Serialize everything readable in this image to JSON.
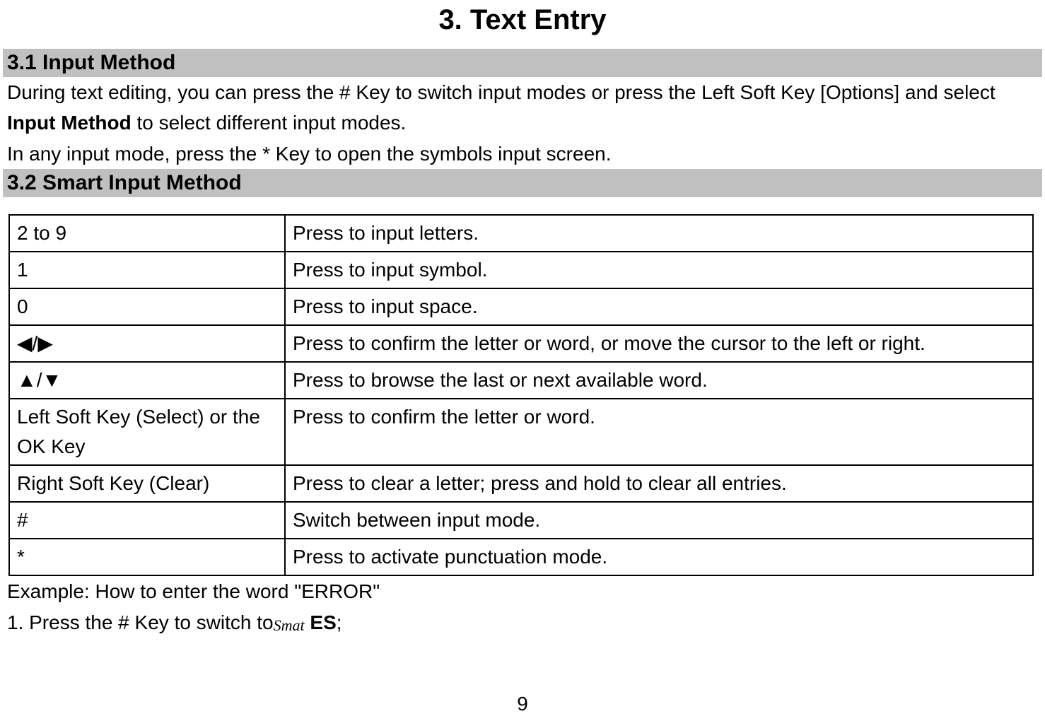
{
  "chapter_title": "3.    Text Entry",
  "section_31": "3.1  Input Method",
  "p1_pre": "During text editing, you can press the # Key to switch input modes or press the Left Soft Key [Options] and select ",
  "p1_bold": "Input Method",
  "p1_post": " to select different input modes.",
  "p2": "In any input mode, press the * Key to open the symbols input screen.",
  "section_32": "3.2  Smart Input Method",
  "table_rows": [
    {
      "key": "2 to 9",
      "desc": "Press to input letters."
    },
    {
      "key": "1",
      "desc": "Press to input symbol."
    },
    {
      "key": "0",
      "desc": "Press to input space."
    },
    {
      "key": "◀/▶",
      "desc": "Press to confirm the letter or word, or move the cursor to the left or right."
    },
    {
      "key": "▲/▼",
      "desc": "Press to browse the last or next available word."
    },
    {
      "key": "Left Soft Key (Select) or the OK Key",
      "desc": "Press to confirm the letter or word."
    },
    {
      "key": "Right Soft Key (Clear)",
      "desc": "Press to clear a letter; press and hold to clear all entries."
    },
    {
      "key": "#",
      "desc": "Switch between input mode."
    },
    {
      "key": "*",
      "desc": "Press to activate punctuation mode."
    }
  ],
  "example_line": "Example: How to enter the word \"ERROR\"",
  "step1_pre": "1. Press the # Key to switch to",
  "smart_icon_text": "Smat",
  "step1_bold": "ES",
  "step1_post": ";",
  "page_number": "9"
}
